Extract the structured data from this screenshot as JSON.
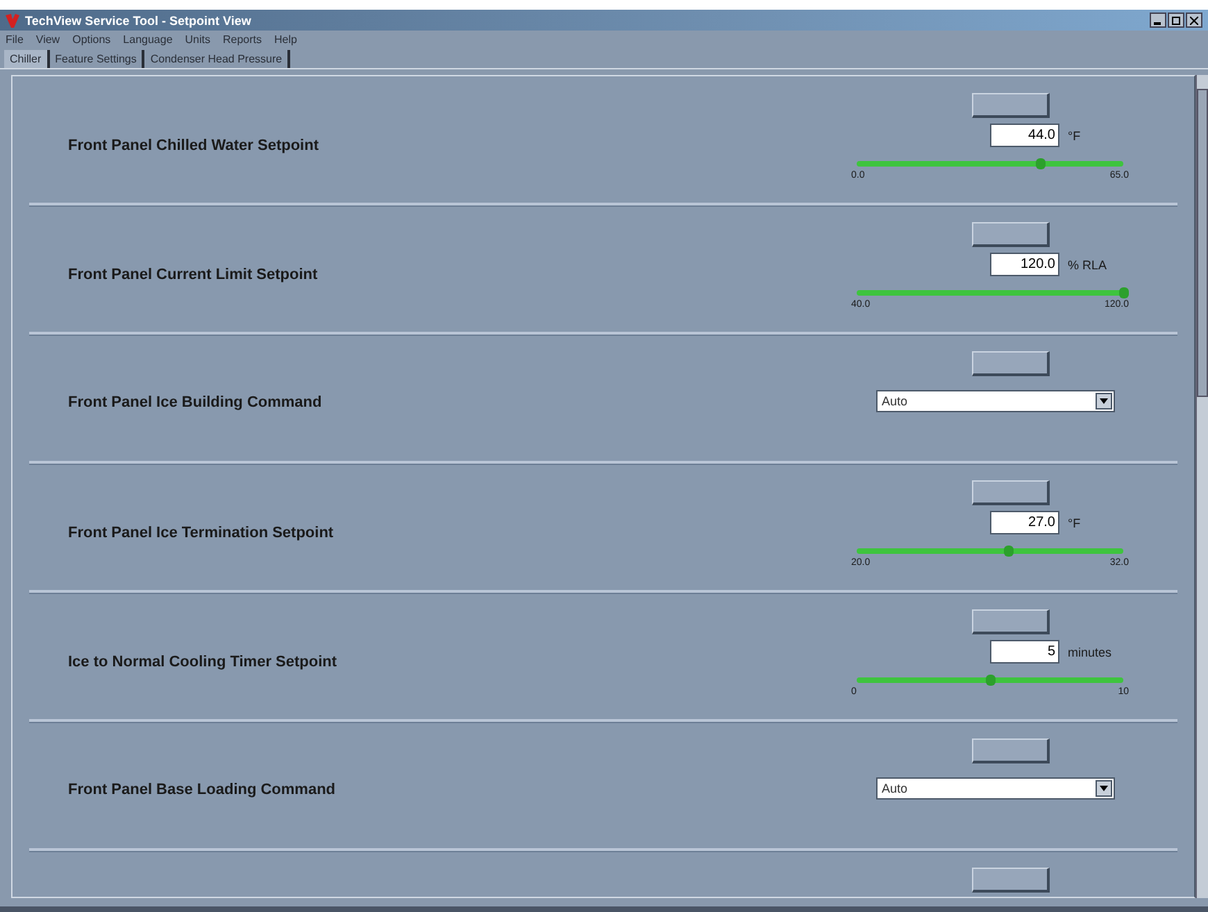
{
  "window": {
    "title": "TechView Service Tool - Setpoint View"
  },
  "menu": [
    "File",
    "View",
    "Options",
    "Language",
    "Units",
    "Reports",
    "Help"
  ],
  "tabs": [
    {
      "label": "Chiller",
      "selected": true
    },
    {
      "label": "Feature Settings",
      "selected": false
    },
    {
      "label": "Condenser Head Pressure",
      "selected": false
    }
  ],
  "setpoints": [
    {
      "kind": "numeric",
      "label": "Front Panel Chilled Water Setpoint",
      "value": "44.0",
      "unit": "°F",
      "level": 0.69,
      "min": "0.0",
      "max": "65.0"
    },
    {
      "kind": "numeric",
      "label": "Front Panel Current Limit Setpoint",
      "value": "120.0",
      "unit": "% RLA",
      "level": 1,
      "min": "40.0",
      "max": "120.0"
    },
    {
      "kind": "choice",
      "label": "Front Panel Ice Building Command",
      "value": "Auto"
    },
    {
      "kind": "numeric",
      "label": "Front Panel Ice Termination Setpoint",
      "value": "27.0",
      "unit": "°F",
      "level": 0.57,
      "min": "20.0",
      "max": "32.0"
    },
    {
      "kind": "numeric",
      "label": "Ice to Normal Cooling Timer Setpoint",
      "value": "5",
      "unit": "minutes",
      "level": 0.5,
      "min": "0",
      "max": "10"
    },
    {
      "kind": "choice",
      "label": "Front Panel Base Loading Command",
      "value": "Auto"
    },
    {
      "kind": "cutoff"
    }
  ]
}
